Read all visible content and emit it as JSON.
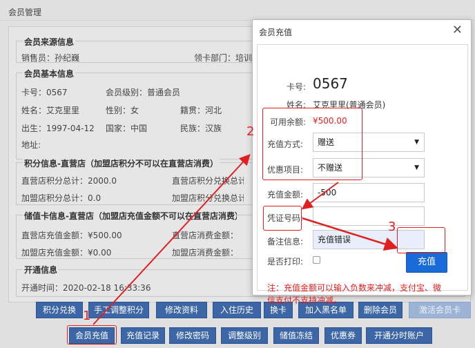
{
  "bg_window": {
    "title": "会员管理",
    "sections": {
      "source_legend": "会员来源信息",
      "salesperson": "销售员：孙纪巍",
      "card_dept": "领卡部门：培训",
      "basic_legend": "会员基本信息",
      "card_no": "卡号：0567",
      "level": "会员级别：普通会员",
      "name": "姓名：艾克里里",
      "gender": "性别：女",
      "native": "籍贯：河北",
      "birth": "出生：1997-04-12",
      "country": "国家：中国",
      "ethnic": "民族：汉族",
      "address": "地址:",
      "points_legend": "积分信息-直营店（加盟店积分不可以在直营店消费）",
      "direct_points": "直营店积分总计：2000.0",
      "direct_points_redeem": "直营店积分兑换总计",
      "franchise_points": "加盟店积分总计：0.0",
      "franchise_points_redeem": "加盟店积分兑换总计",
      "stored_legend": "储值卡信息-直营店（加盟店充值金额不可以在直营店消费）",
      "direct_recharge": "直营店充值金额：¥500.00",
      "direct_consume": "直营店消费金额：",
      "franchise_recharge": "加盟店充值金额：¥0.00",
      "franchise_consume": "加盟店消费金额：",
      "open_legend": "开通信息",
      "open_time": "开通时间：2020-02-18 16:33:36"
    },
    "buttons_row1": [
      "积分兑换",
      "手工调整积分",
      "修改资料",
      "入住历史",
      "换卡",
      "加入黑名单",
      "删除会员",
      "激活会员卡"
    ],
    "buttons_row2": [
      "会员充值",
      "充值记录",
      "修改密码",
      "调整级别",
      "储值冻结",
      "优惠券",
      "开通分时账户"
    ]
  },
  "dialog": {
    "title": "会员充值",
    "card_label": "卡号:",
    "card_value": "0567",
    "name_label": "姓名:",
    "name_value": "艾克里里(普通会员)",
    "balance_label": "可用余额:",
    "balance_value": "¥500.00",
    "method_label": "充值方式:",
    "method_value": "赠送",
    "promo_label": "优惠项目:",
    "promo_value": "不赠送",
    "amount_label": "充值金额:",
    "amount_value": "-500",
    "voucher_label": "凭证号码:",
    "voucher_value": "",
    "remark_label": "备注信息:",
    "remark_value": "充值错误",
    "print_label": "是否打印:",
    "charge_button": "充值",
    "note_line1": "注：充值金额可以输入负数来冲减，支付宝、微",
    "note_line2": "信支付不支持冲减。"
  },
  "annotations": [
    "1",
    "2",
    "3"
  ],
  "colors": {
    "button_blue": "#3c66a6",
    "accent_red": "#e02020",
    "charge_blue": "#1a6ad9"
  }
}
